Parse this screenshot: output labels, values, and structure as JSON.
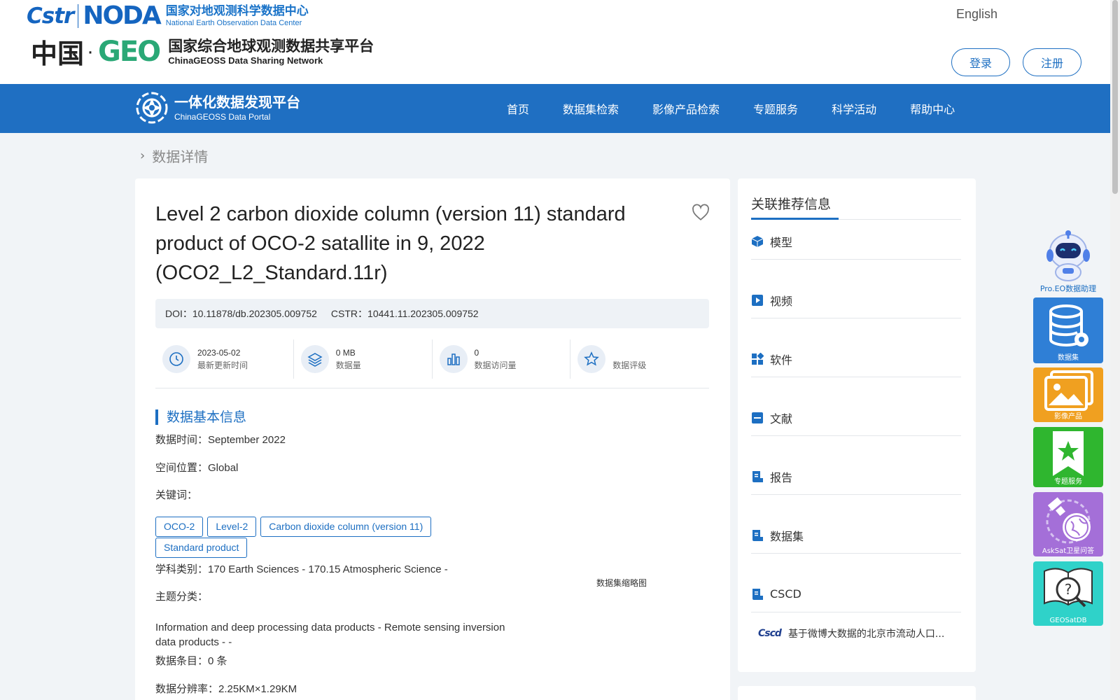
{
  "header": {
    "cstr_logo": "Cstr",
    "noda_logo": "NODA",
    "noda_cn": "国家对地观测科学数据中心",
    "noda_en": "National Earth Observation Data Center",
    "china_logo": "中国",
    "geo_logo": "GEO",
    "geo_cn": "国家综合地球观测数据共享平台",
    "geo_en": "ChinaGEOSS Data Sharing Network",
    "language": "English",
    "login": "登录",
    "register": "注册"
  },
  "nav": {
    "portal_cn": "一体化数据发现平台",
    "portal_en": "ChinaGEOSS Data Portal",
    "items": [
      "首页",
      "数据集检索",
      "影像产品检索",
      "专题服务",
      "科学活动",
      "帮助中心"
    ]
  },
  "breadcrumb": {
    "current": "数据详情"
  },
  "dataset": {
    "title": "Level 2 carbon dioxide column (version 11) standard product of OCO-2 satallite in 9, 2022 (OCO2_L2_Standard.11r)",
    "doi": "DOI：10.11878/db.202305.009752",
    "cstr": "CSTR：10441.11.202305.009752",
    "stats": [
      {
        "value": "2023-05-02",
        "label": "最新更新时间"
      },
      {
        "value": "0 MB",
        "label": "数据量"
      },
      {
        "value": "0",
        "label": "数据访问量"
      },
      {
        "value": "",
        "label": "数据评级"
      }
    ],
    "section_title": "数据基本信息",
    "time_label": "数据时间：",
    "time_value": "September 2022",
    "space_label": "空间位置：",
    "space_value": "Global",
    "keywords_label": "关键词：",
    "keywords": [
      "OCO-2",
      "Level-2",
      "Carbon dioxide column (version 11)",
      "Standard product"
    ],
    "discipline_label": "学科类别：",
    "discipline_value": "170 Earth Sciences - 170.15 Atmospheric Science -",
    "theme_label": "主题分类：",
    "theme_value": "Information and deep processing data products - Remote sensing inversion data products - -",
    "entries_label": "数据条目：",
    "entries_value": "0 条",
    "resolution_label": "数据分辨率：",
    "resolution_value": "2.25KM×1.29KM",
    "thumbnail_label": "数据集缩略图"
  },
  "sidebar": {
    "heading": "关联推荐信息",
    "items": [
      "模型",
      "视频",
      "软件",
      "文献",
      "报告",
      "数据集",
      "CSCD"
    ],
    "cscd_logo": "Cscd",
    "cscd_entry": "基于微博大数据的北京市流动人口..."
  },
  "floating": {
    "assistant": "Pro.EO数据助理",
    "tiles": [
      "数据集",
      "影像产品",
      "专题服务",
      "AskSat卫星问答",
      "GEOSatDB"
    ],
    "colors": [
      "#2f7fd6",
      "#f0a020",
      "#2fb62f",
      "#a46fd8",
      "#2fd2c9"
    ]
  },
  "colors": {
    "primary": "#1f6fc2",
    "background": "#f1f4f7"
  }
}
